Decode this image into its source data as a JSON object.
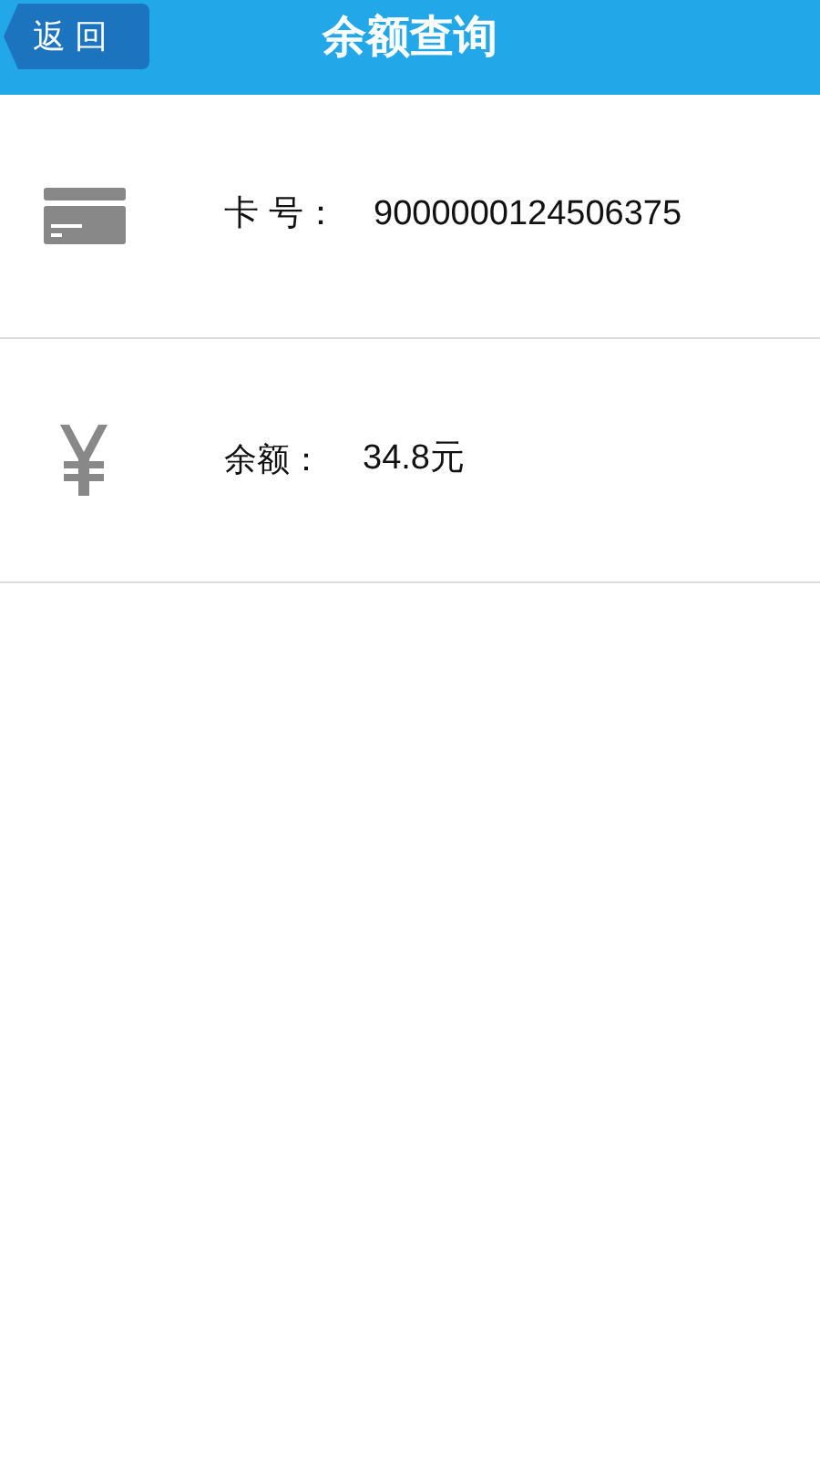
{
  "header": {
    "back_button": "返 回",
    "title": "余额查询"
  },
  "rows": [
    {
      "kind": "card",
      "label": "卡 号：",
      "value": "9000000124506375"
    },
    {
      "kind": "balance",
      "label": "余额：",
      "value": "34.8元"
    }
  ]
}
